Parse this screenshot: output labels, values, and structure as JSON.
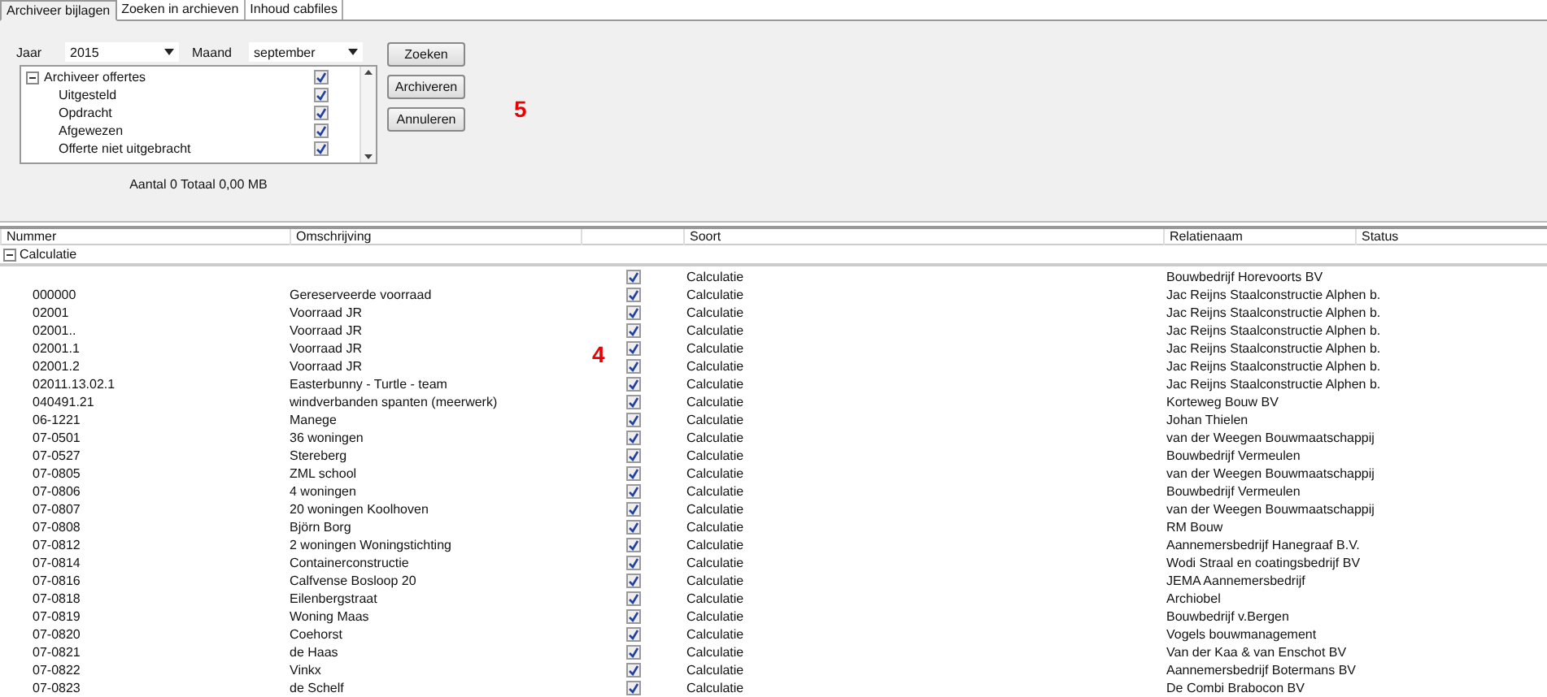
{
  "tabs": [
    {
      "label": "Archiveer bijlagen",
      "selected": true
    },
    {
      "label": "Zoeken in archieven",
      "selected": false
    },
    {
      "label": "Inhoud cabfiles",
      "selected": false
    }
  ],
  "filters": {
    "year_label": "Jaar",
    "year": "2015",
    "month_label": "Maand",
    "month": "september"
  },
  "offer_tree": [
    {
      "label": "Archiveer offertes",
      "checked": true,
      "expanded": true,
      "children": [
        {
          "label": "Uitgesteld",
          "checked": true
        },
        {
          "label": "Opdracht",
          "checked": true
        },
        {
          "label": "Afgewezen",
          "checked": true
        },
        {
          "label": "Offerte niet uitgebracht",
          "checked": true
        }
      ]
    }
  ],
  "summary": "Aantal 0 Totaal 0,00 MB",
  "buttons": [
    "Zoeken",
    "Archiveren",
    "Annuleren"
  ],
  "annotations": [
    {
      "text": "5"
    },
    {
      "text": "4"
    }
  ],
  "table": {
    "columns": [
      "Nummer",
      "Omschrijving",
      "Soort",
      "Relatienaam",
      "Status"
    ],
    "groups": [
      {
        "label": "Calculatie",
        "expanded": true,
        "rows": [
          {
            "checked": true,
            "type": "Calculatie",
            "relation": "Bouwbedrijf Horevoorts BV"
          },
          {
            "number": "000000",
            "description": "Gereserveerde voorraad",
            "checked": true,
            "type": "Calculatie",
            "relation": "Jac Reijns Staalconstructie Alphen b."
          },
          {
            "number": "02001",
            "description": "Voorraad JR",
            "checked": true,
            "type": "Calculatie",
            "relation": "Jac Reijns Staalconstructie Alphen b."
          },
          {
            "number": "02001..",
            "description": "Voorraad JR",
            "checked": true,
            "type": "Calculatie",
            "relation": "Jac Reijns Staalconstructie Alphen b."
          },
          {
            "number": "02001.1",
            "description": "Voorraad JR",
            "checked": true,
            "type": "Calculatie",
            "relation": "Jac Reijns Staalconstructie Alphen b."
          },
          {
            "number": "02001.2",
            "description": "Voorraad JR",
            "checked": true,
            "type": "Calculatie",
            "relation": "Jac Reijns Staalconstructie Alphen b."
          },
          {
            "number": "02011.13.02.1",
            "description": "Easterbunny - Turtle - team",
            "checked": true,
            "type": "Calculatie",
            "relation": "Jac Reijns Staalconstructie Alphen b."
          },
          {
            "number": "040491.21",
            "description": "windverbanden spanten (meerwerk)",
            "checked": true,
            "type": "Calculatie",
            "relation": "Korteweg Bouw BV"
          },
          {
            "number": "06-1221",
            "description": "Manege",
            "checked": true,
            "type": "Calculatie",
            "relation": "Johan Thielen"
          },
          {
            "number": "07-0501",
            "description": "36 woningen",
            "checked": true,
            "type": "Calculatie",
            "relation": "van der Weegen Bouwmaatschappij"
          },
          {
            "number": "07-0527",
            "description": "Stereberg",
            "checked": true,
            "type": "Calculatie",
            "relation": "Bouwbedrijf Vermeulen"
          },
          {
            "number": "07-0805",
            "description": "ZML school",
            "checked": true,
            "type": "Calculatie",
            "relation": "van der Weegen Bouwmaatschappij"
          },
          {
            "number": "07-0806",
            "description": "4 woningen",
            "checked": true,
            "type": "Calculatie",
            "relation": "Bouwbedrijf Vermeulen"
          },
          {
            "number": "07-0807",
            "description": "20 woningen Koolhoven",
            "checked": true,
            "type": "Calculatie",
            "relation": "van der Weegen Bouwmaatschappij"
          },
          {
            "number": "07-0808",
            "description": "Björn Borg",
            "checked": true,
            "type": "Calculatie",
            "relation": "RM Bouw"
          },
          {
            "number": "07-0812",
            "description": "2 woningen Woningstichting",
            "checked": true,
            "type": "Calculatie",
            "relation": "Aannemersbedrijf Hanegraaf B.V."
          },
          {
            "number": "07-0814",
            "description": "Containerconstructie",
            "checked": true,
            "type": "Calculatie",
            "relation": "Wodi Straal en coatingsbedrijf BV"
          },
          {
            "number": "07-0816",
            "description": "Calfvense Bosloop 20",
            "checked": true,
            "type": "Calculatie",
            "relation": "JEMA Aannemersbedrijf"
          },
          {
            "number": "07-0818",
            "description": "Eilenbergstraat",
            "checked": true,
            "type": "Calculatie",
            "relation": "Archiobel"
          },
          {
            "number": "07-0819",
            "description": "Woning Maas",
            "checked": true,
            "type": "Calculatie",
            "relation": "Bouwbedrijf v.Bergen"
          },
          {
            "number": "07-0820",
            "description": "Coehorst",
            "checked": true,
            "type": "Calculatie",
            "relation": "Vogels bouwmanagement"
          },
          {
            "number": "07-0821",
            "description": "de Haas",
            "checked": true,
            "type": "Calculatie",
            "relation": "Van der Kaa & van Enschot BV"
          },
          {
            "number": "07-0822",
            "description": "Vinkx",
            "checked": true,
            "type": "Calculatie",
            "relation": "Aannemersbedrijf Botermans BV"
          },
          {
            "number": "07-0823",
            "description": "de Schelf",
            "checked": true,
            "type": "Calculatie",
            "relation": "De Combi Brabocon BV"
          }
        ]
      }
    ]
  }
}
